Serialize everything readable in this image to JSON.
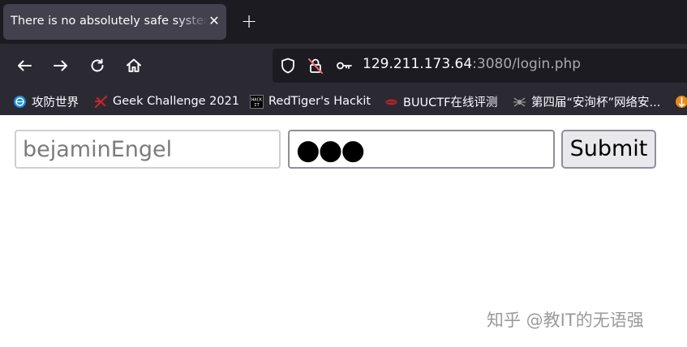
{
  "tab": {
    "title": "There is no absolutely safe system",
    "close_icon": "close-icon",
    "new_tab_icon": "plus-icon"
  },
  "nav": {
    "back_icon": "back-arrow-icon",
    "forward_icon": "forward-arrow-icon",
    "reload_icon": "reload-icon",
    "home_icon": "home-icon",
    "url_host": "129.211.173.64",
    "url_rest": ":3080/login.php",
    "shield_icon": "shield-icon",
    "insecure_icon": "lock-slashed-icon",
    "key_icon": "key-icon"
  },
  "bookmarks": [
    {
      "label": "攻防世界",
      "icon": "globe-icon"
    },
    {
      "label": "Geek Challenge 2021",
      "icon": "geek-icon"
    },
    {
      "label": "RedTiger's Hackit",
      "icon": "hackit-icon"
    },
    {
      "label": "BUUCTF在线评测",
      "icon": "buuctf-icon"
    },
    {
      "label": "第四届“安洵杯”网络安...",
      "icon": "spider-icon"
    }
  ],
  "form": {
    "username_value": "bejaminEngel",
    "password_mask": "●●●",
    "submit_label": "Submit"
  },
  "watermark": "知乎 @教IT的无语强",
  "colors": {
    "tabbar": "#1c1b22",
    "toolbar": "#2b2a33",
    "active_tab": "#42414d"
  }
}
